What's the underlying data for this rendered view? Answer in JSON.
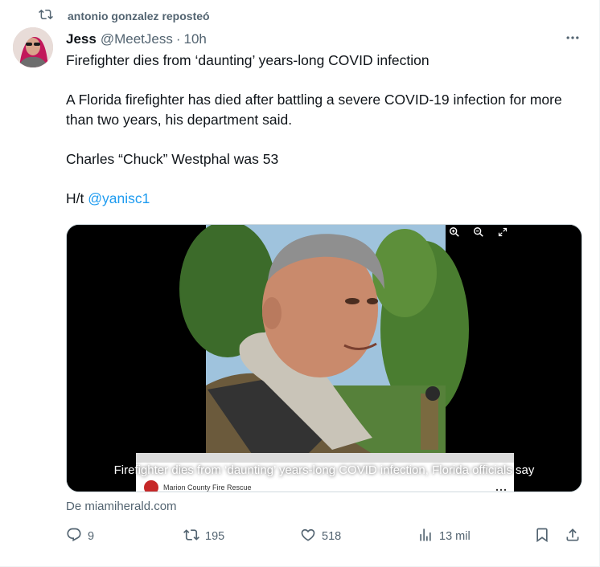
{
  "repost": {
    "text": "antonio gonzalez reposteó",
    "icon": "repost-icon"
  },
  "author": {
    "name": "Jess",
    "handle": "@MeetJess",
    "separator": "·",
    "time": "10h",
    "avatar": "avatar-image"
  },
  "tweet": {
    "line1": "Firefighter dies from ‘daunting’ years-long COVID infection",
    "line2": "A Florida firefighter has died after battling a severe COVID-19 infection for more than two years, his department said.",
    "line3": "Charles “Chuck” Westphal was 53",
    "ht_prefix": "H/t",
    "mention": "@yanisc1"
  },
  "media": {
    "caption": "Firefighter dies from ‘daunting’ years-long COVID infection, Florida officials say",
    "logo_text": "Marion County Fire Rescue",
    "viewer_icons": [
      "zoom-in-icon",
      "zoom-out-icon",
      "expand-icon"
    ]
  },
  "source": {
    "text": "De miamiherald.com"
  },
  "actions": {
    "reply_count": "9",
    "repost_count": "195",
    "like_count": "518",
    "views_count": "13 mil"
  },
  "colors": {
    "text": "#0f1419",
    "muted": "#536471",
    "link": "#1d9bf0",
    "border": "#cfd9de"
  }
}
